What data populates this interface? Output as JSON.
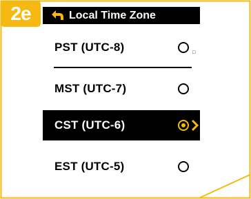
{
  "step_badge": "2e",
  "screen": {
    "title": "Local Time Zone",
    "options": [
      {
        "label": "PST (UTC-8)",
        "selected": false
      },
      {
        "label": "MST (UTC-7)",
        "selected": false
      },
      {
        "label": "CST (UTC-6)",
        "selected": true
      },
      {
        "label": "EST (UTC-5)",
        "selected": false
      }
    ]
  },
  "colors": {
    "accent": "#f5b912",
    "frame_border": "#f5b912",
    "screen_bg": "#ffffff",
    "highlight_bg": "#000000"
  },
  "icons": {
    "back": "back-arrow-icon",
    "radio": "radio-icon",
    "chevron": "chevron-right-icon"
  }
}
